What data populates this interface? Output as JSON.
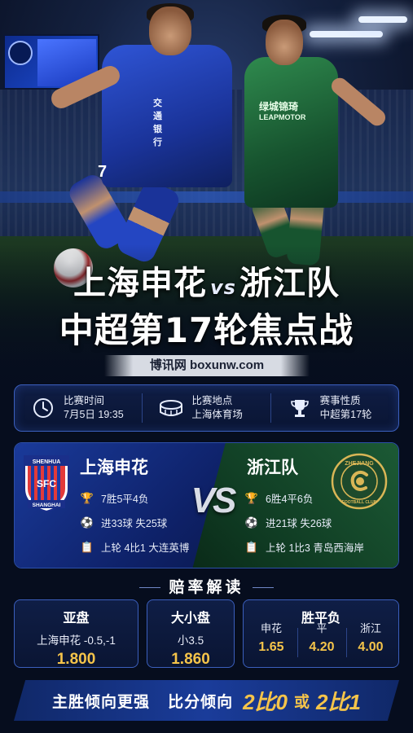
{
  "hero": {
    "blue_shirt_text": "交通银行",
    "blue_number": "7",
    "green_shirt_text": "绿城锦琦",
    "green_shirt_text2": "LEAPMOTOR"
  },
  "title": {
    "home": "上海申花",
    "vs": "vs",
    "away": "浙江队",
    "subtitle": "中超第17轮焦点战"
  },
  "site": "博讯网 boxunw.com",
  "info": [
    {
      "icon": "clock-icon",
      "label": "比赛时间",
      "value": "7月5日 19:35"
    },
    {
      "icon": "stadium-icon",
      "label": "比赛地点",
      "value": "上海体育场"
    },
    {
      "icon": "trophy-icon",
      "label": "赛事性质",
      "value": "中超第17轮"
    }
  ],
  "home_team": {
    "name": "上海申花",
    "badge_top": "SHENHUA",
    "badge_mid": "SFC",
    "badge_bottom": "SHANGHAI",
    "record": "7胜5平4负",
    "goals": "进33球 失25球",
    "last": "上轮 4比1 大连英博"
  },
  "away_team": {
    "name": "浙江队",
    "badge_top": "ZHEJIANG",
    "badge_bottom": "FOOTBALL CLUB",
    "record": "6胜4平6负",
    "goals": "进21球 失26球",
    "last": "上轮 1比3 青岛西海岸"
  },
  "vs_big": "VS",
  "odds": {
    "title": "赔率解读",
    "asian": {
      "label": "亚盘",
      "line": "上海申花 -0.5,-1",
      "value": "1.800"
    },
    "total": {
      "label": "大小盘",
      "line": "小3.5",
      "value": "1.860"
    },
    "wdl": {
      "label": "胜平负",
      "items": [
        {
          "label": "申花",
          "value": "1.65"
        },
        {
          "label": "平",
          "value": "4.20"
        },
        {
          "label": "浙江",
          "value": "4.00"
        }
      ]
    }
  },
  "banner": {
    "lean": "主胜倾向更强",
    "score_label": "比分倾向",
    "score1": "2比0",
    "or": "或",
    "score2": "2比1"
  },
  "colors": {
    "accent_gold": "#f5c44a",
    "home_blue": "#1a3a9a",
    "away_green": "#1c5a35"
  }
}
